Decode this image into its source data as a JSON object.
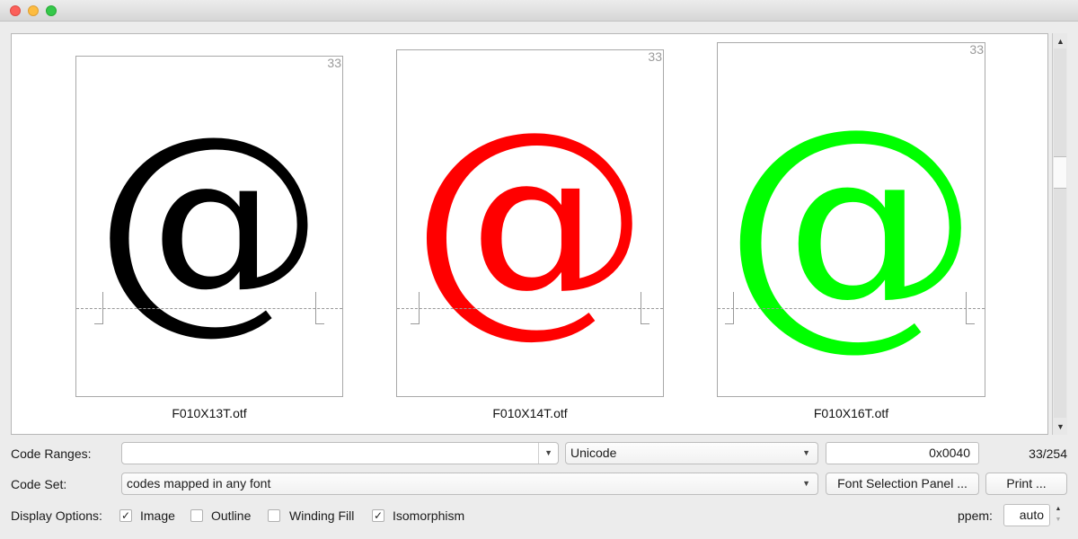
{
  "window": {
    "controls": [
      "close",
      "minimize",
      "maximize"
    ]
  },
  "glyph_view": {
    "cells": [
      {
        "code_index": "33",
        "glyph": "@",
        "color": "#000000",
        "font_file": "F010X13T.otf"
      },
      {
        "code_index": "33",
        "glyph": "@",
        "color": "#ff0000",
        "font_file": "F010X14T.otf"
      },
      {
        "code_index": "33",
        "glyph": "@",
        "color": "#00ff00",
        "font_file": "F010X16T.otf"
      }
    ],
    "scrollbar": {
      "up_arrow": "▲",
      "down_arrow": "▼",
      "position_fraction": 0.33
    }
  },
  "controls": {
    "code_ranges": {
      "label": "Code Ranges:",
      "value": "",
      "caret": "▼"
    },
    "encoding": {
      "value": "Unicode",
      "caret": "▼"
    },
    "code_value": "0x0040",
    "position_counter": "33/254",
    "code_set": {
      "label": "Code Set:",
      "value": "codes mapped in any font",
      "caret": "▼"
    },
    "font_selection_button": "Font Selection Panel ...",
    "print_button": "Print ...",
    "display_options": {
      "label": "Display Options:",
      "options": [
        {
          "label": "Image",
          "checked": true,
          "mark": "✓"
        },
        {
          "label": "Outline",
          "checked": false,
          "mark": ""
        },
        {
          "label": "Winding Fill",
          "checked": false,
          "mark": ""
        },
        {
          "label": "Isomorphism",
          "checked": true,
          "mark": "✓"
        }
      ]
    },
    "ppem": {
      "label": "ppem:",
      "value": "auto",
      "up": "▲",
      "down": "▼"
    }
  }
}
